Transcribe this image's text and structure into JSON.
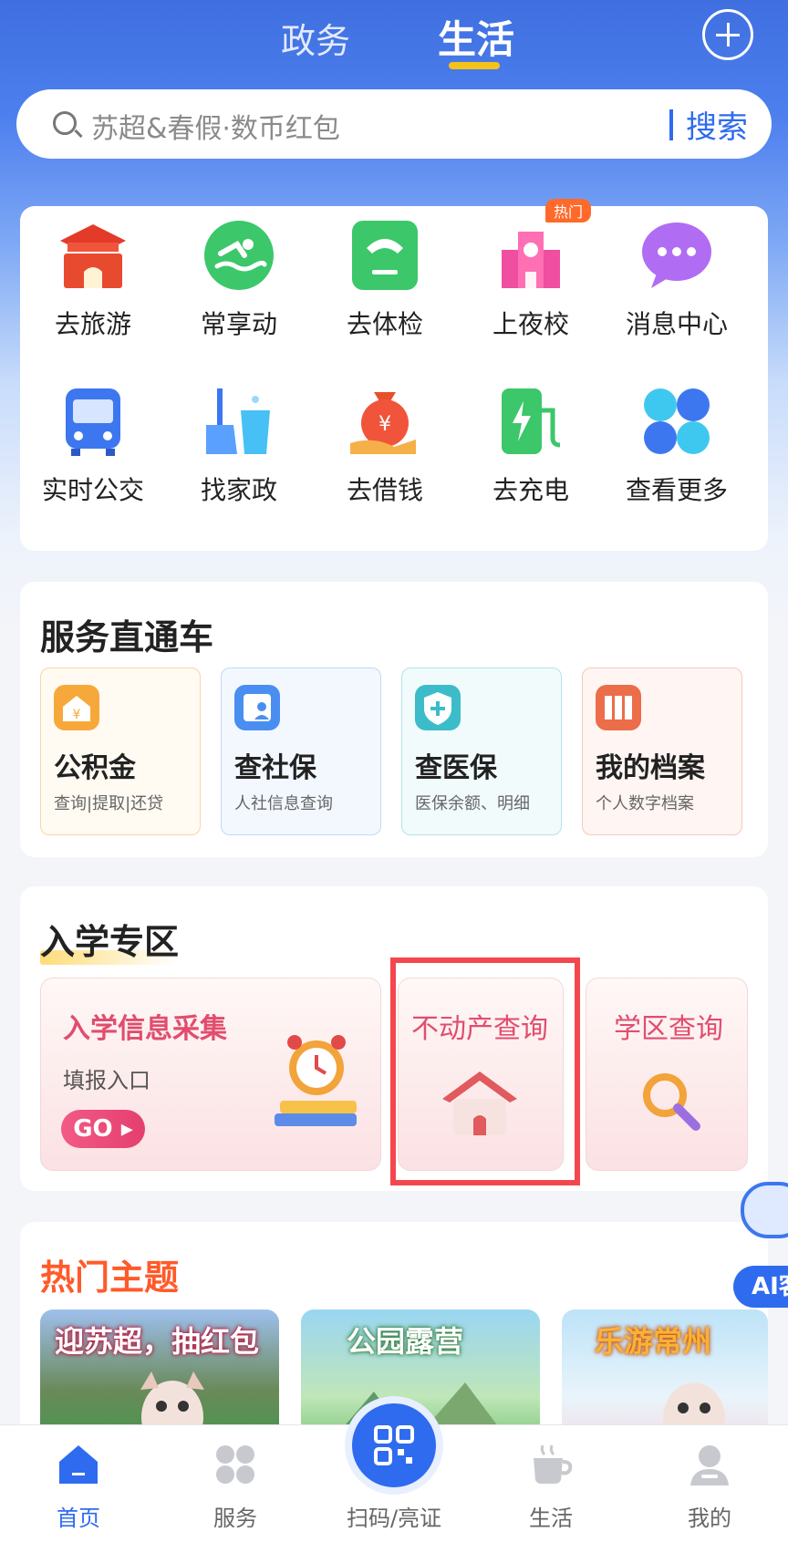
{
  "header": {
    "tab_gov": "政务",
    "tab_life": "生活",
    "add_icon": "plus-circle-icon"
  },
  "search": {
    "placeholder": "苏超&春假·数币红包",
    "button": "搜索"
  },
  "quick_services": [
    {
      "label": "去旅游",
      "icon": "temple-icon"
    },
    {
      "label": "常享动",
      "icon": "swim-icon"
    },
    {
      "label": "去体检",
      "icon": "scale-icon"
    },
    {
      "label": "上夜校",
      "icon": "school-icon",
      "badge": "热门"
    },
    {
      "label": "消息中心",
      "icon": "chat-bubble-icon"
    },
    {
      "label": "实时公交",
      "icon": "bus-icon"
    },
    {
      "label": "找家政",
      "icon": "cleaning-icon"
    },
    {
      "label": "去借钱",
      "icon": "money-bag-icon"
    },
    {
      "label": "去充电",
      "icon": "charging-station-icon"
    },
    {
      "label": "查看更多",
      "icon": "grid-more-icon"
    }
  ],
  "direct": {
    "title": "服务直通车",
    "items": [
      {
        "title": "公积金",
        "sub": "查询|提取|还贷",
        "icon": "house-fund-icon"
      },
      {
        "title": "查社保",
        "sub": "人社信息查询",
        "icon": "social-security-icon"
      },
      {
        "title": "查医保",
        "sub": "医保余额、明细",
        "icon": "medical-insurance-icon"
      },
      {
        "title": "我的档案",
        "sub": "个人数字档案",
        "icon": "archive-icon"
      }
    ]
  },
  "enroll": {
    "title": "入学专区",
    "info_title": "入学信息采集",
    "info_sub": "填报入口",
    "go": "GO",
    "property_title": "不动产查询",
    "district_title": "学区查询"
  },
  "hot": {
    "title": "热门主题",
    "cards": [
      {
        "caption": "迎苏超，抽红包"
      },
      {
        "caption": "公园露营"
      },
      {
        "caption": "乐游常州"
      }
    ]
  },
  "ai": {
    "label": "AI客"
  },
  "tabbar": {
    "home": "首页",
    "services": "服务",
    "scan": "扫码/亮证",
    "life": "生活",
    "mine": "我的"
  },
  "colors": {
    "accent": "#2f6bef",
    "hot": "#ff5a2a",
    "badge": "#ff6a2a",
    "highlight": "#f4474d"
  }
}
